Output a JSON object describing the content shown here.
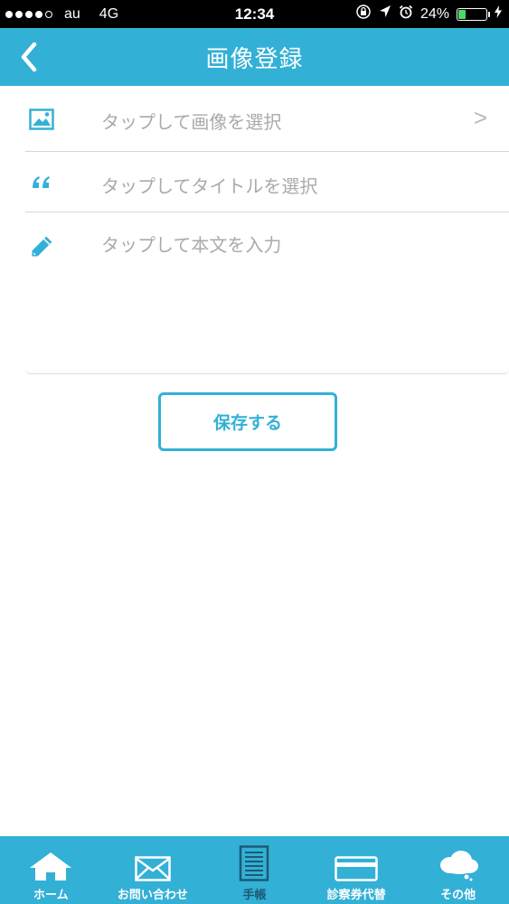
{
  "status_bar": {
    "carrier": "au",
    "network": "4G",
    "time": "12:34",
    "battery_text": "24%",
    "battery_level": 0.24,
    "signal_filled": 4,
    "signal_total": 5
  },
  "header": {
    "title": "画像登録",
    "back_icon": "chevron-left-icon"
  },
  "form": {
    "image_row": {
      "placeholder": "タップして画像を選択",
      "icon": "image-icon",
      "chevron": ">"
    },
    "title_row": {
      "placeholder": "タップしてタイトルを選択",
      "icon": "quote-icon"
    },
    "body_row": {
      "placeholder": "タップして本文を入力",
      "icon": "pencil-icon"
    }
  },
  "save_button": {
    "label": "保存する"
  },
  "tab_bar": {
    "items": [
      {
        "label": "ホーム",
        "icon": "home-icon",
        "active": false
      },
      {
        "label": "お問い合わせ",
        "icon": "mail-icon",
        "active": false
      },
      {
        "label": "手帳",
        "icon": "notebook-icon",
        "active": true
      },
      {
        "label": "診察券代替",
        "icon": "card-icon",
        "active": false
      },
      {
        "label": "その他",
        "icon": "cloud-icon",
        "active": false
      }
    ]
  },
  "colors": {
    "primary": "#33b0d6",
    "placeholder": "#aaaaaa",
    "active_tab_label": "#1c5a73"
  }
}
